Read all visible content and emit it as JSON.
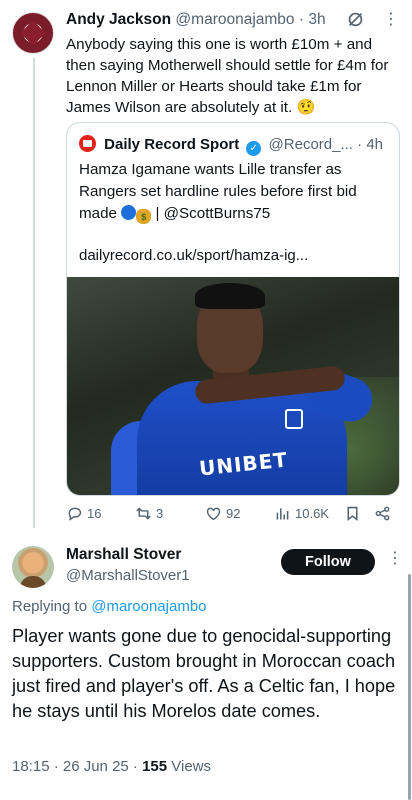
{
  "tweet1": {
    "name": "Andy Jackson",
    "handle": "@maroonajambo",
    "time": "· 3h",
    "text": "Anybody saying this one is worth £10m + and then saying Motherwell should settle for £4m for Lennon Miller or Hearts should take £1m for James Wilson are absolutely at it. 🤨",
    "quote": {
      "name": "Daily Record Sport",
      "handle": "@Record_...",
      "time": "· 4h",
      "text_before": "Hamza Igamane wants Lille transfer as Rangers set hardline rules before first bid made ",
      "text_after": " | @ScottBurns75",
      "link": "dailyrecord.co.uk/sport/hamza-ig...",
      "photo_text": "UNIBET"
    },
    "actions": {
      "replies": "16",
      "reposts": "3",
      "likes": "92",
      "views": "10.6K"
    }
  },
  "tweet2": {
    "name": "Marshall Stover",
    "handle": "@MarshallStover1",
    "follow_label": "Follow",
    "replying_prefix": "Replying to ",
    "replying_to": "@maroonajambo",
    "text": "Player wants gone due to genocidal-supporting supporters. Custom brought in Moroccan coach just fired and player's off. As a Celtic fan, I hope he stays until his Morelos date comes.",
    "timestamp": "18:15 · 26 Jun 25 · ",
    "views_count": "155",
    "views_label": " Views"
  },
  "icons": [
    "grok-icon",
    "more-icon",
    "reply-icon",
    "repost-icon",
    "like-icon",
    "views-icon",
    "bookmark-icon",
    "share-icon",
    "verified-icon"
  ],
  "colors": {
    "accent": "#1d9bf0",
    "text": "#0f1419",
    "muted": "#536471",
    "border": "#cfd9de"
  }
}
